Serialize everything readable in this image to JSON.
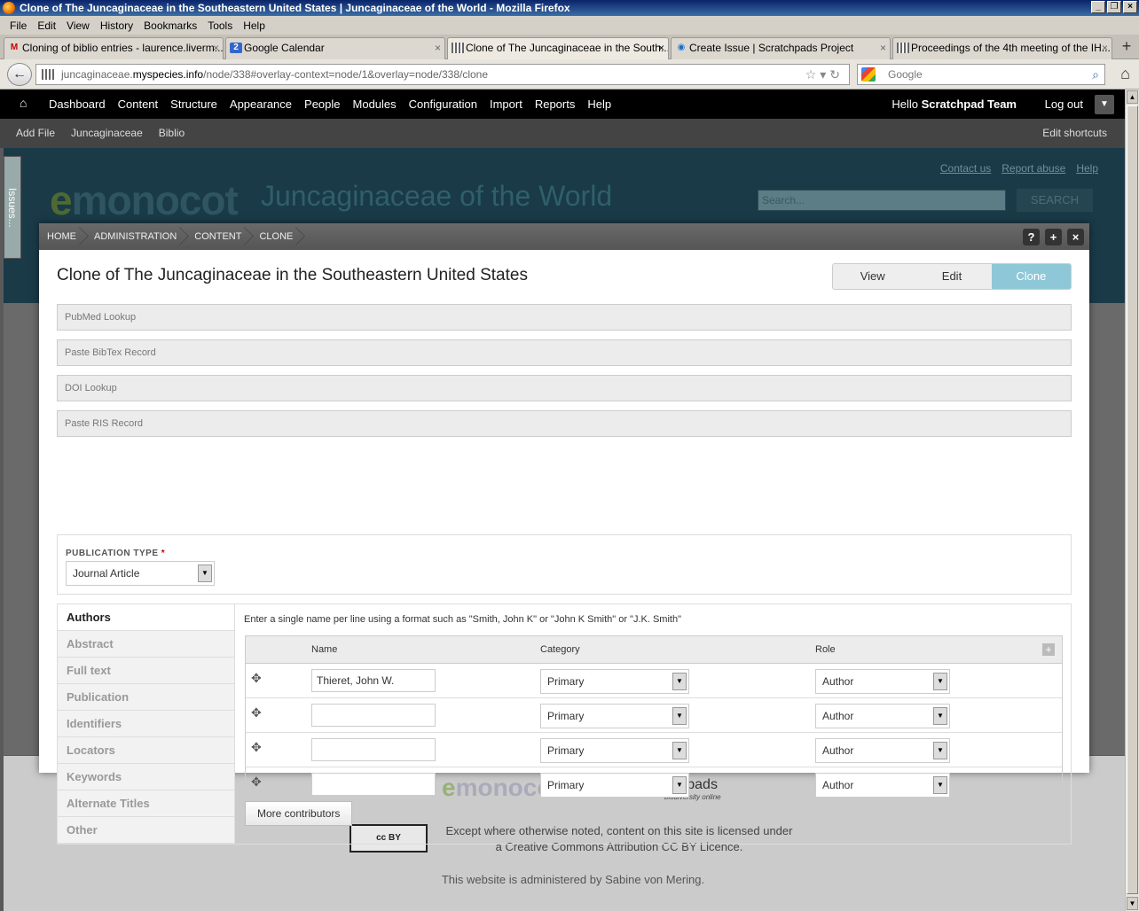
{
  "window": {
    "title": "Clone of The Juncaginaceae in the Southeastern United States | Juncaginaceae of the World - Mozilla Firefox"
  },
  "menubar": [
    "File",
    "Edit",
    "View",
    "History",
    "Bookmarks",
    "Tools",
    "Help"
  ],
  "tabs": [
    {
      "label": "Cloning of biblio entries - laurence.liverm...",
      "icon": "gmail-icon",
      "active": false
    },
    {
      "label": "Google Calendar",
      "icon": "calendar-icon",
      "active": false
    },
    {
      "label": "Clone of The Juncaginaceae in the South...",
      "icon": "grid-icon",
      "active": true
    },
    {
      "label": "Create Issue | Scratchpads Project",
      "icon": "globe-icon",
      "active": false
    },
    {
      "label": "Proceedings of the 4th meeting of the IH...",
      "icon": "grid-icon",
      "active": false
    }
  ],
  "navbar": {
    "url_prefix": "juncaginaceae.",
    "url_host": "myspecies.info",
    "url_path": "/node/338#overlay-context=node/1&overlay=node/338/clone",
    "search_placeholder": "Google"
  },
  "toolbar": {
    "items": [
      "Dashboard",
      "Content",
      "Structure",
      "Appearance",
      "People",
      "Modules",
      "Configuration",
      "Import",
      "Reports",
      "Help"
    ],
    "hello": "Hello ",
    "user": "Scratchpad Team",
    "logout": "Log out"
  },
  "shortcuts": {
    "items": [
      "Add File",
      "Juncaginaceae",
      "Biblio"
    ],
    "edit": "Edit shortcuts"
  },
  "issues_tab": "Issues...",
  "site": {
    "links": [
      "Contact us",
      "Report abuse",
      "Help"
    ],
    "logo_e": "e",
    "logo_rest": "monocot",
    "name": "Juncaginaceae of the World",
    "search_placeholder": "Search...",
    "search_button": "SEARCH"
  },
  "overlay": {
    "breadcrumbs": [
      "HOME",
      "ADMINISTRATION",
      "CONTENT",
      "CLONE"
    ],
    "buttons": [
      "?",
      "+",
      "×"
    ],
    "title": "Clone of The Juncaginaceae in the Southeastern United States",
    "tabs": [
      {
        "label": "View",
        "active": false
      },
      {
        "label": "Edit",
        "active": false
      },
      {
        "label": "Clone",
        "active": true
      }
    ],
    "collapsibles": [
      "PubMed Lookup",
      "Paste BibTex Record",
      "DOI Lookup",
      "Paste RIS Record"
    ],
    "publication_type": {
      "label": "PUBLICATION TYPE",
      "required_mark": "*",
      "value": "Journal Article"
    },
    "vertical_tabs": [
      "Authors",
      "Abstract",
      "Full text",
      "Publication",
      "Identifiers",
      "Locators",
      "Keywords",
      "Alternate Titles",
      "Other"
    ],
    "authors_help": "Enter a single name per line using a format such as \"Smith, John K\" or \"John K Smith\" or \"J.K. Smith\"",
    "table_headers": {
      "name": "Name",
      "category": "Category",
      "role": "Role"
    },
    "contributors": [
      {
        "name": "Thieret, John W.",
        "category": "Primary",
        "role": "Author"
      },
      {
        "name": "",
        "category": "Primary",
        "role": "Author"
      },
      {
        "name": "",
        "category": "Primary",
        "role": "Author"
      },
      {
        "name": "",
        "category": "Primary",
        "role": "Author"
      }
    ],
    "more_button": "More contributors"
  },
  "footer": {
    "logo_e": "e",
    "logo_rest": "monocot",
    "scratchpads": "Scratchpads",
    "scratchpads_sub": "biodiversity online",
    "cc_badge": "cc  BY",
    "license": "Except where otherwise noted, content on this site is licensed under a Creative Commons Attribution CC BY Licence.",
    "admin": "This website is administered by Sabine von Mering."
  }
}
